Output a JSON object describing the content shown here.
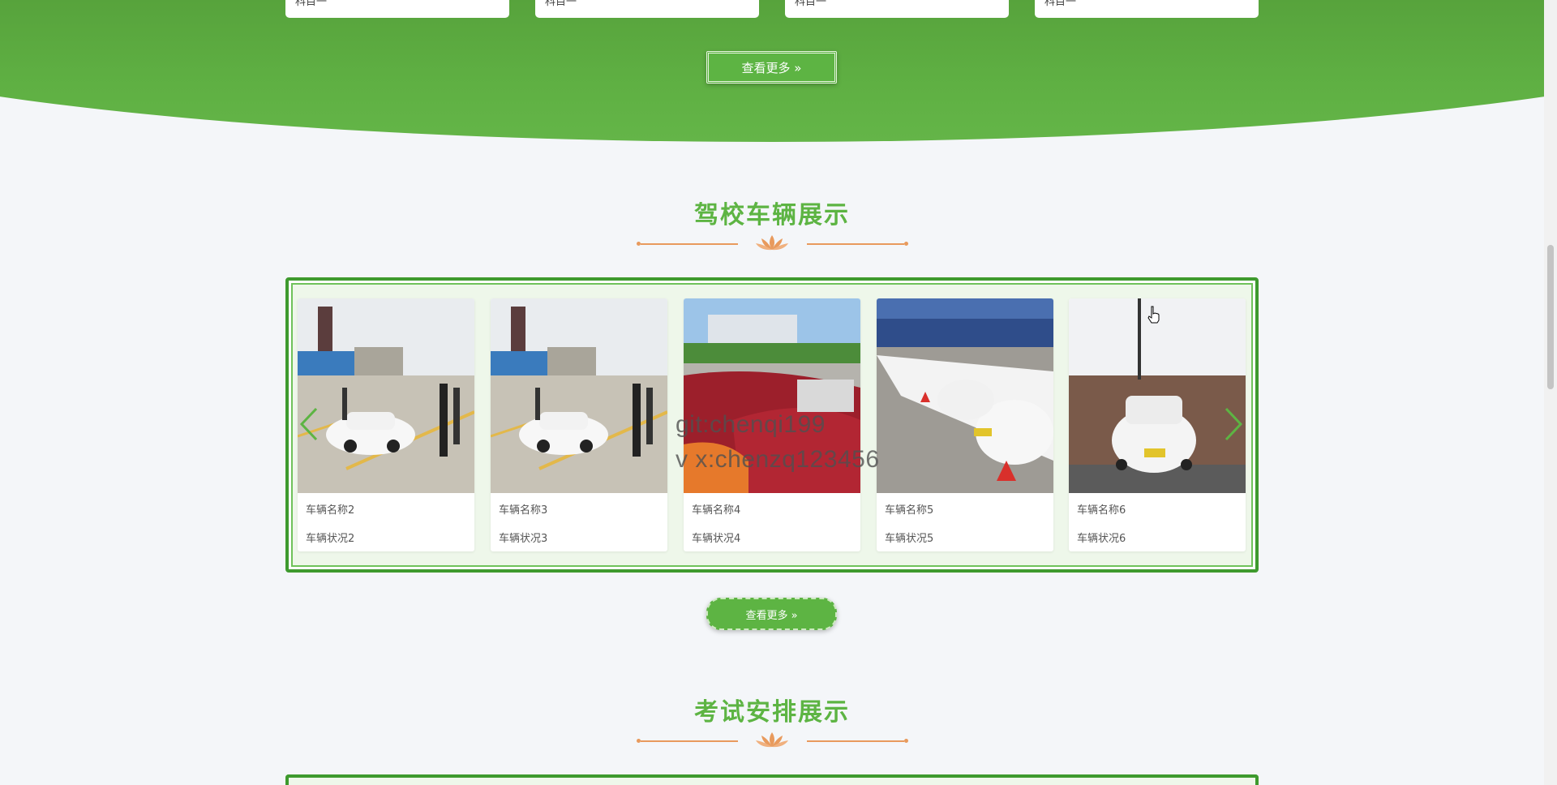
{
  "top_section": {
    "category_cards": [
      "科目一",
      "科目一",
      "科目一",
      "科目一"
    ],
    "more_label": "查看更多 »"
  },
  "vehicle_section": {
    "title": "驾校车辆展示",
    "cars": [
      {
        "name": "车辆名称2",
        "status": "车辆状况2"
      },
      {
        "name": "车辆名称3",
        "status": "车辆状况3"
      },
      {
        "name": "车辆名称4",
        "status": "车辆状况4"
      },
      {
        "name": "车辆名称5",
        "status": "车辆状况5"
      },
      {
        "name": "车辆名称6",
        "status": "车辆状况6"
      }
    ],
    "more_label": "查看更多 »"
  },
  "watermark": {
    "line1": "git:chenqi199",
    "line2": "v x:chenzq123456"
  },
  "exam_section": {
    "title": "考试安排展示"
  },
  "colors": {
    "brand_green": "#5db443",
    "accent_orange": "#e89a5d",
    "panel_border": "#3e9a2e"
  }
}
